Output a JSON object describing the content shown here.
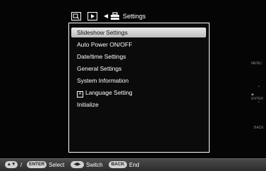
{
  "header": {
    "title": "Settings",
    "mode_icon_a": "photo-sort-icon",
    "mode_icon_b": "slideshow-icon",
    "arrow_icon": "triangle-left-icon",
    "settings_icon": "toolbox-icon"
  },
  "menu": {
    "items": [
      {
        "label": "Slideshow Settings",
        "selected": true
      },
      {
        "label": "Auto Power ON/OFF",
        "selected": false
      },
      {
        "label": "Date/time Settings",
        "selected": false
      },
      {
        "label": "General Settings",
        "selected": false
      },
      {
        "label": "System Information",
        "selected": false
      },
      {
        "label": "Language Setting",
        "selected": false,
        "icon": "A"
      },
      {
        "label": "Initialize",
        "selected": false
      }
    ]
  },
  "side": {
    "menu_label": "MENU",
    "enter_label": "◆ ENTER",
    "back_label": "BACK"
  },
  "bottom_bar": {
    "nav_pill": "▲▼",
    "slash": "/",
    "enter_pill": "ENTER",
    "select_label": "Select",
    "switch_pill": "◀▶",
    "switch_label": "Switch",
    "back_pill": "BACK",
    "end_label": "End"
  },
  "colors": {
    "background": "#050505",
    "selected_bg": "#d8d8d8",
    "bar_bg": "#3a3a3a"
  }
}
